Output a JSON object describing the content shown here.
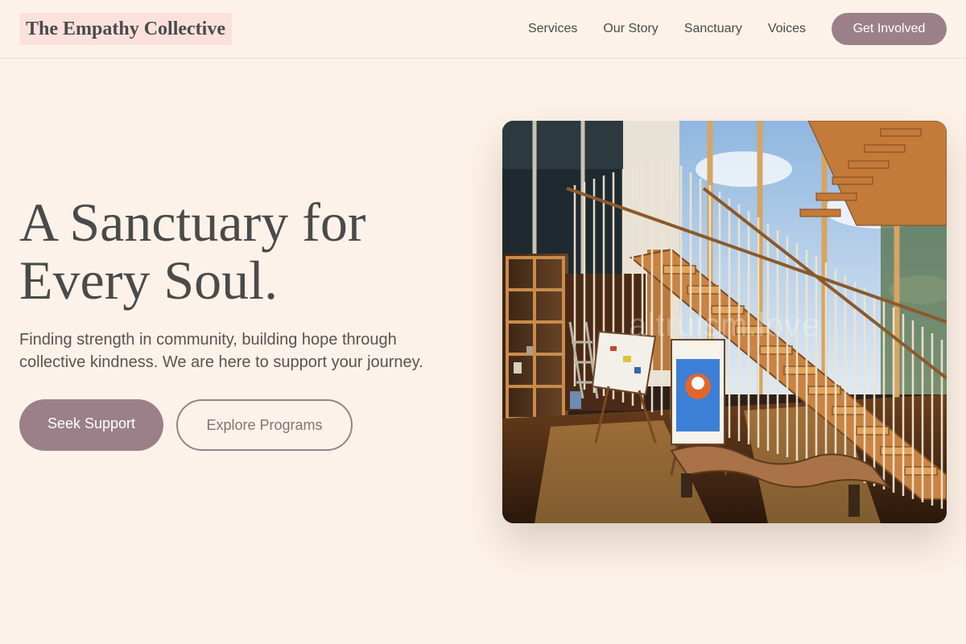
{
  "header": {
    "brand": "The Empathy Collective",
    "nav": [
      "Services",
      "Our Story",
      "Sanctuary",
      "Voices"
    ],
    "cta": "Get Involved"
  },
  "hero": {
    "title_line1": "A Sanctuary for",
    "title_line2": "Every Soul.",
    "subtitle_line1": "Finding strength in community, building hope through",
    "subtitle_line2": "collective kindness. We are here to support your journey.",
    "primary_button": "Seek Support",
    "secondary_button": "Explore Programs",
    "image_watermark": "altruism.love"
  },
  "colors": {
    "background": "#fdf2e9",
    "accent": "#9b8089",
    "brand_highlight": "#fbe1dc",
    "text": "#4a4a4a"
  }
}
